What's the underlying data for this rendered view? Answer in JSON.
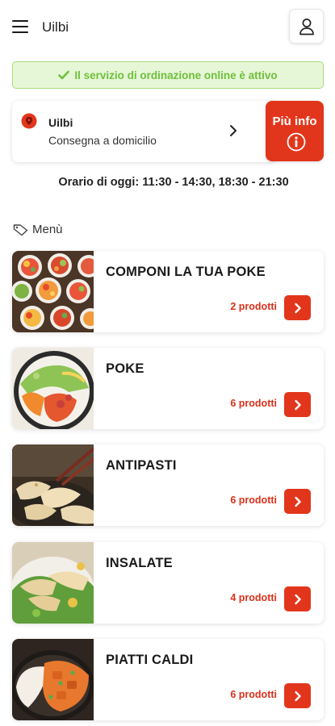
{
  "header": {
    "title": "Uilbi",
    "menu_icon": "hamburger-menu-icon",
    "user_icon": "user-icon"
  },
  "banner": {
    "text": "Il servizio di ordinazione online è attivo",
    "icon": "check-icon",
    "color": "#6fbf3c"
  },
  "store": {
    "name": "Uilbi",
    "delivery_mode": "Consegna a domicilio",
    "icon": "location-pin-icon"
  },
  "info_button": {
    "label": "Più info",
    "icon": "info-icon"
  },
  "hours": {
    "text": "Orario di oggi: 11:30 - 14:30, 18:30 - 21:30"
  },
  "menu": {
    "label": "Menù",
    "icon": "tag-icon",
    "categories": [
      {
        "title": "COMPONI LA TUA POKE",
        "count": "2 prodotti",
        "image": "poke-bowls-photo"
      },
      {
        "title": "POKE",
        "count": "6 prodotti",
        "image": "poke-bowl-photo"
      },
      {
        "title": "ANTIPASTI",
        "count": "6 prodotti",
        "image": "dumplings-photo"
      },
      {
        "title": "INSALATE",
        "count": "4 prodotti",
        "image": "salad-photo"
      },
      {
        "title": "PIATTI CALDI",
        "count": "6 prodotti",
        "image": "curry-rice-photo"
      }
    ]
  },
  "colors": {
    "accent": "#e2361c",
    "banner_bg": "#e6f7d7",
    "banner_border": "#a8dc7d"
  }
}
